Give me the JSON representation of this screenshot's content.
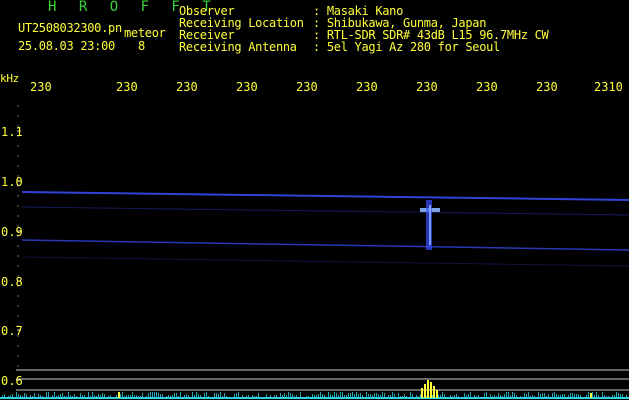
{
  "header": {
    "app_name": "H R O F F T",
    "filename": "UT2508032300.pn",
    "detection_label": "meteor",
    "datetime": "25.08.03 23:00",
    "count": "8",
    "info": [
      {
        "label": "Observer",
        "value": ": Masaki Kano"
      },
      {
        "label": "Receiving Location",
        "value": ": Shibukawa, Gunma, Japan"
      },
      {
        "label": "Receiver",
        "value": ": RTL-SDR SDR# 43dB L15 96.7MHz CW"
      },
      {
        "label": "Receiving Antenna",
        "value": ": 5el Yagi Az 280 for Seoul"
      }
    ]
  },
  "axis": {
    "y_unit": "kHz",
    "y_ticks": [
      "1.1",
      "1.0",
      "0.9",
      "0.8",
      "0.7",
      "0.6"
    ],
    "x_ticks": [
      "230",
      "230",
      "230",
      "230",
      "230",
      "230",
      "230",
      "230",
      "230",
      "2310"
    ]
  },
  "colors": {
    "text": "#ffff3a",
    "title": "#3cd23c",
    "signal": "#3a50ff",
    "echo": "#8cb4ff",
    "grid": "#c8c8c8",
    "baseline": "#30d0e0",
    "peak": "#ffff3a"
  }
}
